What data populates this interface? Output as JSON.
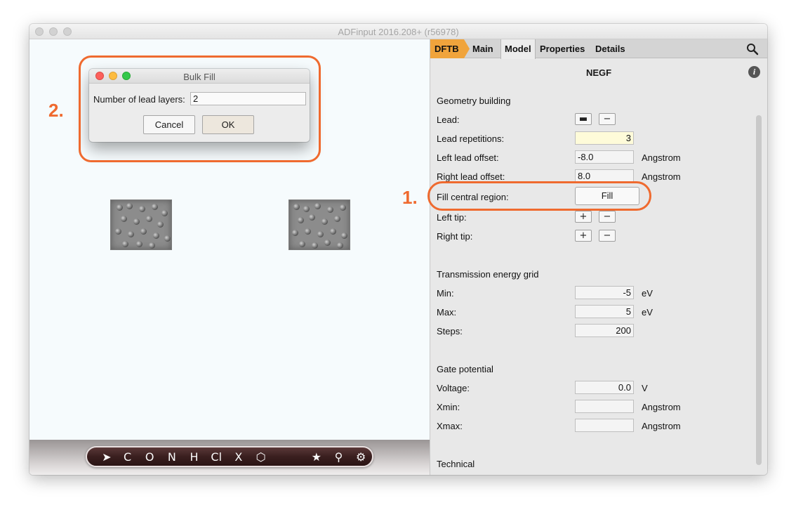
{
  "window": {
    "title": "ADFinput 2016.208+ (r56978)"
  },
  "dialog": {
    "title": "Bulk Fill",
    "label": "Number of lead layers:",
    "value": "2",
    "cancel_label": "Cancel",
    "ok_label": "OK"
  },
  "tabs": [
    "DFTB",
    "Main",
    "Model",
    "Properties",
    "Details"
  ],
  "panel": {
    "heading": "NEGF",
    "info_icon": "i",
    "sections": {
      "geometry": "Geometry building",
      "transmission": "Transmission energy grid",
      "gate": "Gate potential",
      "technical": "Technical"
    },
    "lead": {
      "label": "Lead:"
    },
    "lead_repetitions": {
      "label": "Lead repetitions:",
      "value": "3"
    },
    "left_lead_offset": {
      "label": "Left lead offset:",
      "value": "-8.0",
      "unit": "Angstrom"
    },
    "right_lead_offset": {
      "label": "Right lead offset:",
      "value": "8.0",
      "unit": "Angstrom"
    },
    "fill_central": {
      "label": "Fill central region:",
      "button": "Fill"
    },
    "left_tip": {
      "label": "Left tip:"
    },
    "right_tip": {
      "label": "Right tip:"
    },
    "min": {
      "label": "Min:",
      "value": "-5",
      "unit": "eV"
    },
    "max": {
      "label": "Max:",
      "value": "5",
      "unit": "eV"
    },
    "steps": {
      "label": "Steps:",
      "value": "200"
    },
    "voltage": {
      "label": "Voltage:",
      "value": "0.0",
      "unit": "V"
    },
    "xmin": {
      "label": "Xmin:",
      "value": "",
      "unit": "Angstrom"
    },
    "xmax": {
      "label": "Xmax:",
      "value": "",
      "unit": "Angstrom"
    }
  },
  "toolbar": {
    "tools": [
      "C",
      "O",
      "N",
      "H",
      "Cl",
      "X"
    ]
  },
  "annotations": {
    "step1": "1.",
    "step2": "2."
  },
  "colors": {
    "accent": "#ef6a2f",
    "dftb_tab": "#f0a43c"
  }
}
